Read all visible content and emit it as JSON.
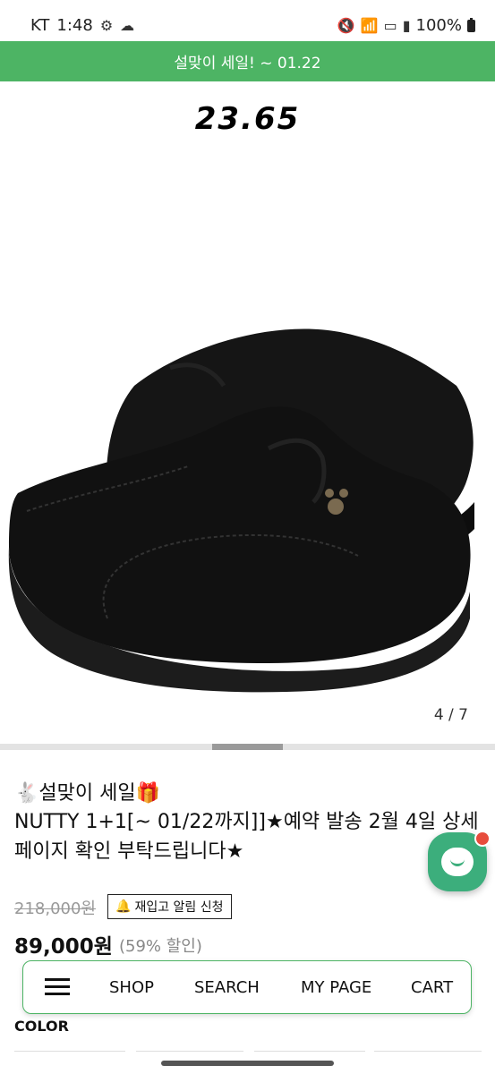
{
  "status_bar": {
    "carrier": "KT",
    "time": "1:48",
    "battery": "100%"
  },
  "banner": {
    "text": "설맞이 세일! ~ 01.22"
  },
  "product_image": {
    "brand_logo": "23.65",
    "slide_counter": "4 / 7",
    "icons": [
      "rabbit-emoji",
      "gift-emoji"
    ]
  },
  "product": {
    "title_line1": "🐇설맞이 세일🎁",
    "title_main": "NUTTY 1+1[~ 01/22까지]]★예약 발송 2월 4일 상세페이지 확인 부탁드립니다★",
    "original_price": "218,000원",
    "restock_label": "재입고 알림 신청",
    "sale_price": "89,000원",
    "discount": "(59% 할인)"
  },
  "bottom_nav": {
    "items": [
      "SHOP",
      "SEARCH",
      "MY PAGE",
      "CART"
    ]
  },
  "options": {
    "color_label": "COLOR"
  },
  "colors": {
    "accent": "#4db464",
    "chat": "#3cae7c"
  }
}
